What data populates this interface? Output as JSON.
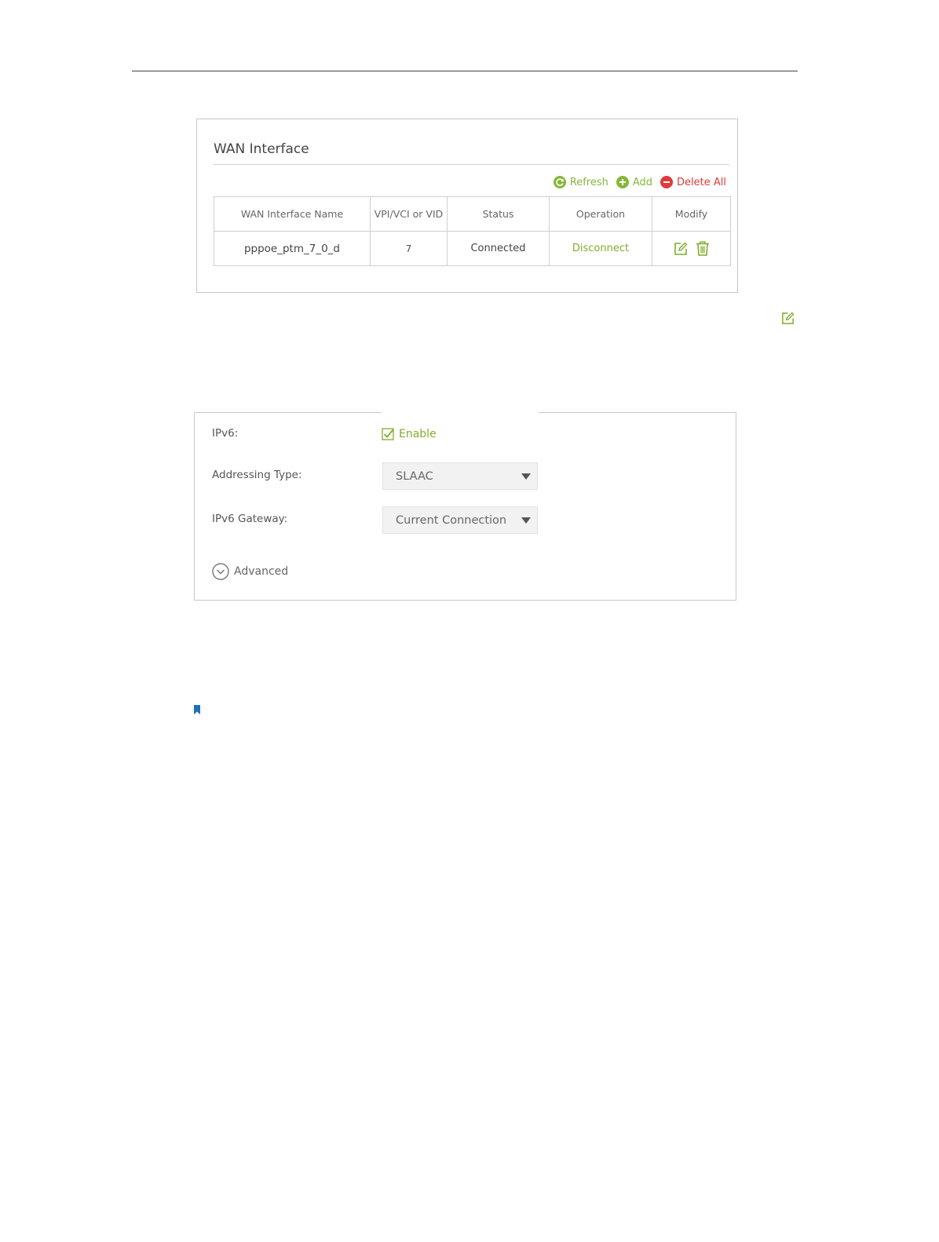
{
  "wan": {
    "title": "WAN Interface",
    "toolbar": {
      "refresh": "Refresh",
      "add": "Add",
      "delete_all": "Delete All"
    },
    "columns": [
      "WAN Interface Name",
      "VPI/VCI or VID",
      "Status",
      "Operation",
      "Modify"
    ],
    "rows": [
      {
        "name": "pppoe_ptm_7_0_d",
        "vid": "7",
        "status": "Connected",
        "operation": "Disconnect"
      }
    ]
  },
  "ipv6": {
    "ipv6_label": "IPv6:",
    "enable_label": "Enable",
    "addressing_label": "Addressing Type:",
    "addressing_value": "SLAAC",
    "gateway_label": "IPv6 Gateway:",
    "gateway_value": "Current Connection",
    "advanced_label": "Advanced"
  },
  "colors": {
    "accent_green": "#7fae2c",
    "danger_red": "#e03a3a",
    "bookmark_blue": "#1e6fc0"
  }
}
